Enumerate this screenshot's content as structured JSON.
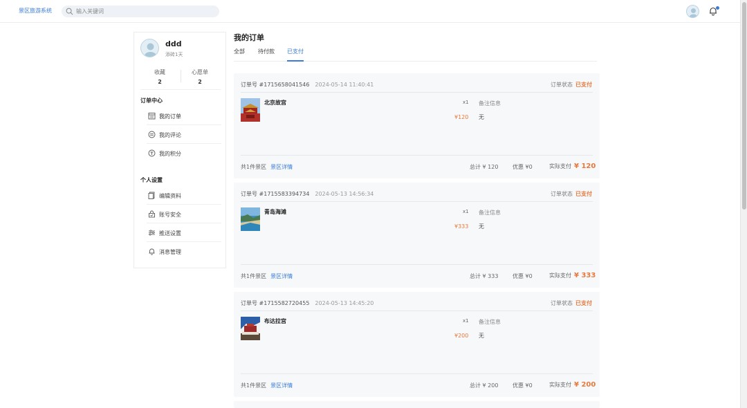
{
  "header": {
    "brand": "景区旅游系统",
    "search_placeholder": "输入关键词"
  },
  "profile": {
    "username": "ddd",
    "days": "添砖1天",
    "stats": [
      {
        "label": "收藏",
        "value": "2"
      },
      {
        "label": "心愿单",
        "value": "2"
      }
    ]
  },
  "sidebar": {
    "order_center_title": "订单中心",
    "order_items": [
      {
        "label": "我的订单",
        "icon": "calendar-icon"
      },
      {
        "label": "我的评论",
        "icon": "comment-icon"
      },
      {
        "label": "我的积分",
        "icon": "points-icon"
      }
    ],
    "settings_title": "个人设置",
    "settings_items": [
      {
        "label": "编辑资料",
        "icon": "document-icon"
      },
      {
        "label": "账号安全",
        "icon": "lock-icon"
      },
      {
        "label": "推送设置",
        "icon": "sliders-icon"
      },
      {
        "label": "消息管理",
        "icon": "bell-icon"
      }
    ]
  },
  "main": {
    "title": "我的订单",
    "tabs": [
      "全部",
      "待付款",
      "已支付"
    ],
    "active_tab": "已支付"
  },
  "labels": {
    "order_no_prefix": "订单号 #",
    "status_label": "订单状态",
    "remark_label": "备注信息",
    "count_text": "共1件景区",
    "detail_link": "景区详情",
    "total_label": "总计",
    "discount_label": "优惠",
    "paid_label": "实际支付"
  },
  "orders": [
    {
      "order_no": "订单号 #1715658041546",
      "time": "2024-05-14 11:40:41",
      "status": "已支付",
      "name": "北京故宫",
      "qty": "x1",
      "price": "¥120",
      "remark": "无",
      "total": "¥ 120",
      "discount": "¥0",
      "paid": "¥ 120"
    },
    {
      "order_no": "订单号 #1715583394734",
      "time": "2024-05-13 14:56:34",
      "status": "已支付",
      "name": "青岛海滩",
      "qty": "x1",
      "price": "¥333",
      "remark": "无",
      "total": "¥ 333",
      "discount": "¥0",
      "paid": "¥ 333"
    },
    {
      "order_no": "订单号 #1715582720455",
      "time": "2024-05-13 14:45:20",
      "status": "已支付",
      "name": "布达拉宫",
      "qty": "x1",
      "price": "¥200",
      "remark": "无",
      "total": "¥ 200",
      "discount": "¥0",
      "paid": "¥ 200"
    }
  ],
  "colors": {
    "accent": "#3a7bd5",
    "price": "#e8783b"
  }
}
